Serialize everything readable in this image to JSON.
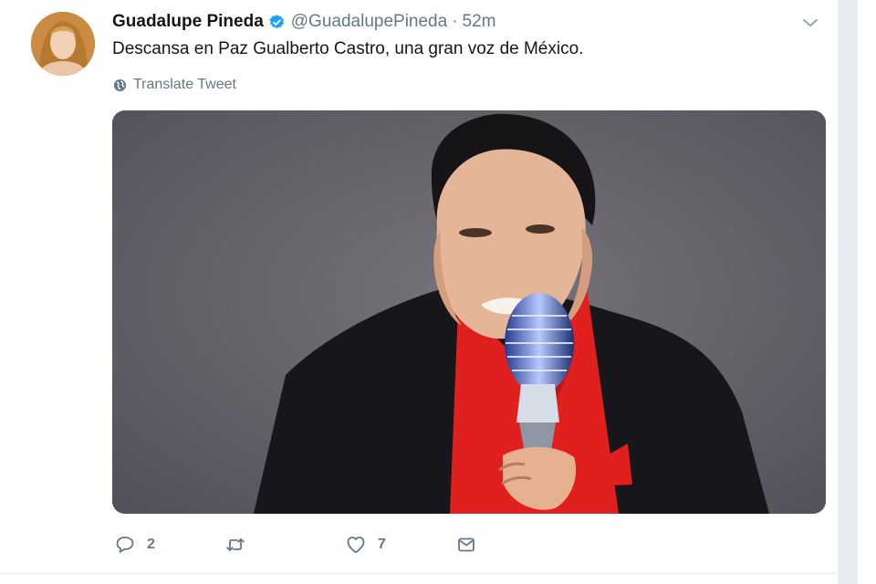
{
  "tweet": {
    "display_name": "Guadalupe Pineda",
    "handle": "@GuadalupePineda",
    "separator": "·",
    "time": "52m",
    "text": "Descansa en Paz Gualberto Castro, una gran voz de México.",
    "translate_label": "Translate Tweet",
    "avatar_alt": "Guadalupe Pineda avatar",
    "verified_icon": "verified-badge",
    "media_alt": "Photo of a man in a black suit and red shirt singing into a vintage microphone"
  },
  "actions": {
    "reply_count": "2",
    "retweet_count": "",
    "like_count": "7"
  },
  "colors": {
    "accent": "#1da1f2",
    "muted": "#657786",
    "text": "#14171a",
    "media_bg": "#5d5a61",
    "shirt_red": "#e0201e"
  }
}
